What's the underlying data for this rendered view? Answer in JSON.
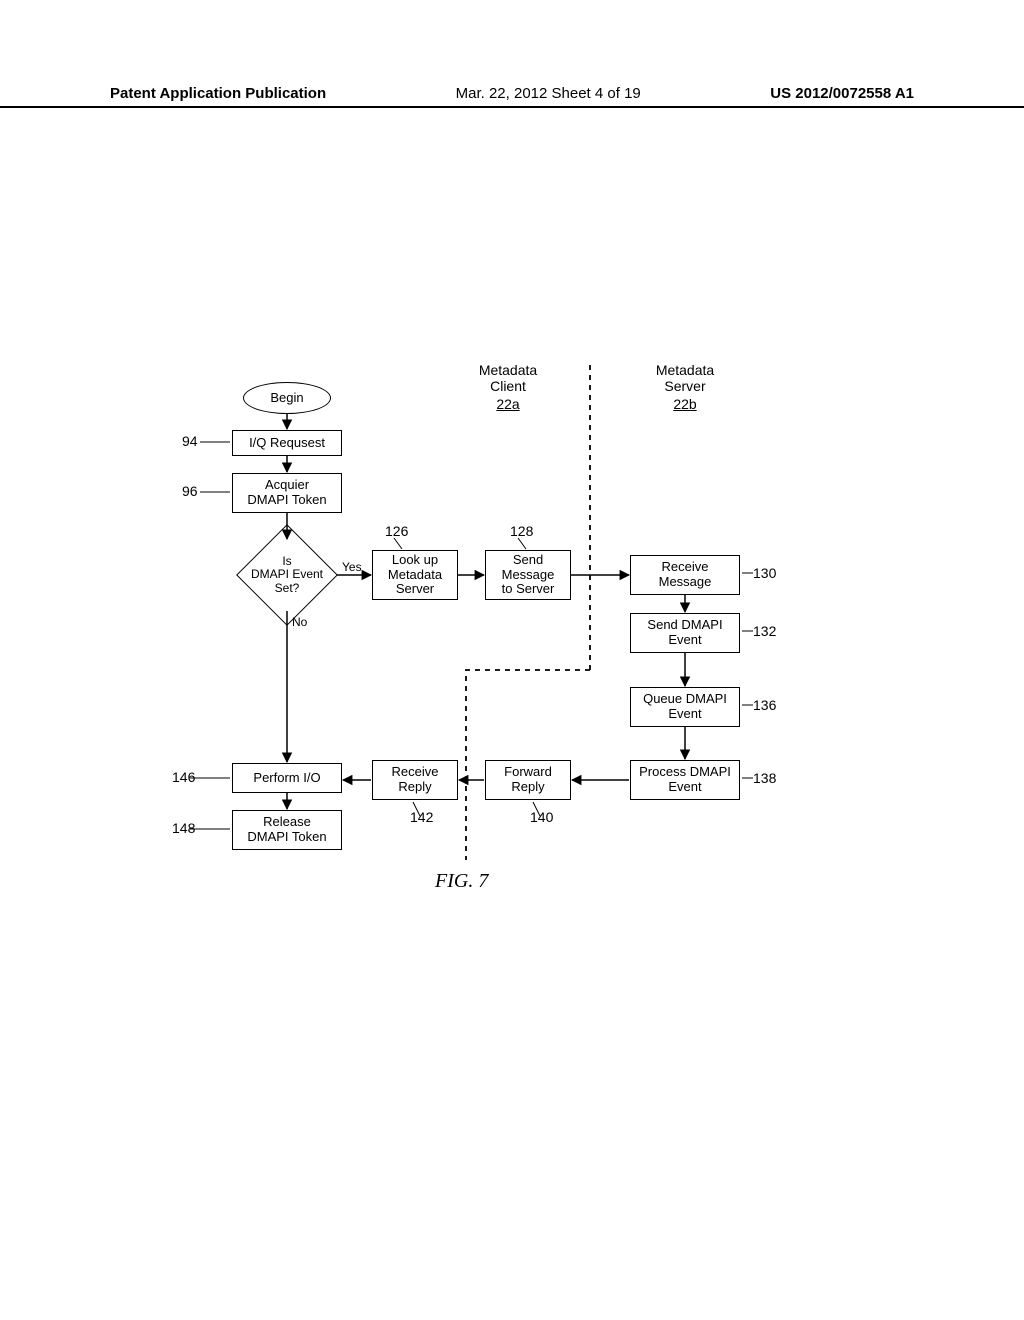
{
  "header": {
    "left": "Patent Application Publication",
    "mid": "Mar. 22, 2012  Sheet 4 of 19",
    "right": "US 2012/0072558 A1"
  },
  "columns": {
    "client_title": "Metadata\nClient",
    "client_ref": "22a",
    "server_title": "Metadata\nServer",
    "server_ref": "22b"
  },
  "nodes": {
    "begin": "Begin",
    "iq_request": "I/Q Requsest",
    "acquire_token": "Acquier\nDMAPI Token",
    "decision": "Is\nDMAPI Event\nSet?",
    "lookup": "Look up\nMetadata\nServer",
    "send_msg": "Send\nMessage\nto Server",
    "receive_msg": "Receive\nMessage",
    "send_event": "Send DMAPI\nEvent",
    "queue_event": "Queue DMAPI\nEvent",
    "process_event": "Process DMAPI\nEvent",
    "forward_reply": "Forward\nReply",
    "receive_reply": "Receive\nReply",
    "perform_io": "Perform I/O",
    "release_token": "Release\nDMAPI Token"
  },
  "edge_labels": {
    "yes": "Yes",
    "no": "No"
  },
  "refs": {
    "r94": "94",
    "r96": "96",
    "r126": "126",
    "r128": "128",
    "r130": "130",
    "r132": "132",
    "r136": "136",
    "r138": "138",
    "r140": "140",
    "r142": "142",
    "r146": "146",
    "r148": "148"
  },
  "figure_label": "FIG. 7"
}
